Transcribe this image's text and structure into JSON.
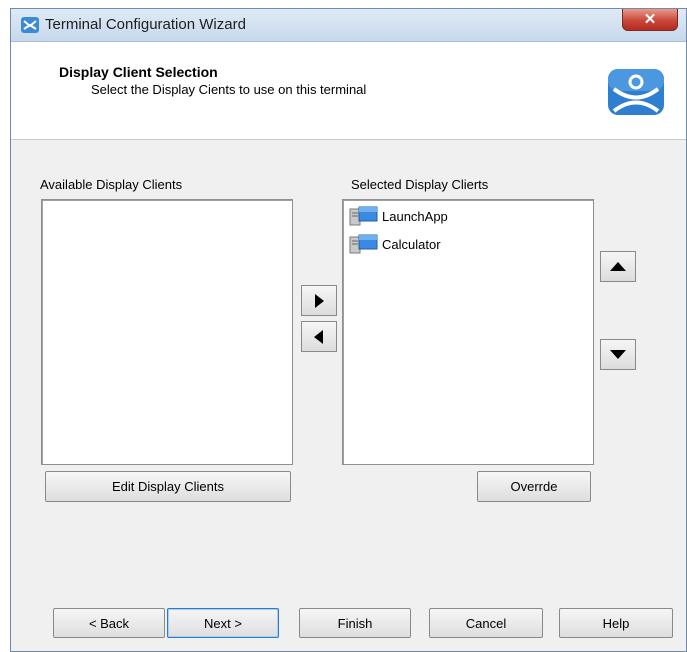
{
  "window": {
    "title": "Terminal Configuration Wizard",
    "close_label": "✕"
  },
  "header": {
    "title": "Display Client Selection",
    "subtitle": "Select the Display Cients to use on this terminal"
  },
  "available": {
    "label": "Available Display Clients",
    "items": []
  },
  "selected": {
    "label": "Selected Display Clierts",
    "items": [
      {
        "label": "LaunchApp"
      },
      {
        "label": "Calculator"
      }
    ]
  },
  "buttons": {
    "edit": "Edit Display Clients",
    "override": "Overrde",
    "back": "< Back",
    "next": "Next >",
    "finish": "Finish",
    "cancel": "Cancel",
    "help": "Help"
  },
  "colors": {
    "titlebar": "#c6d8ec",
    "close": "#c9473a",
    "logo": "#2f7fd0"
  }
}
